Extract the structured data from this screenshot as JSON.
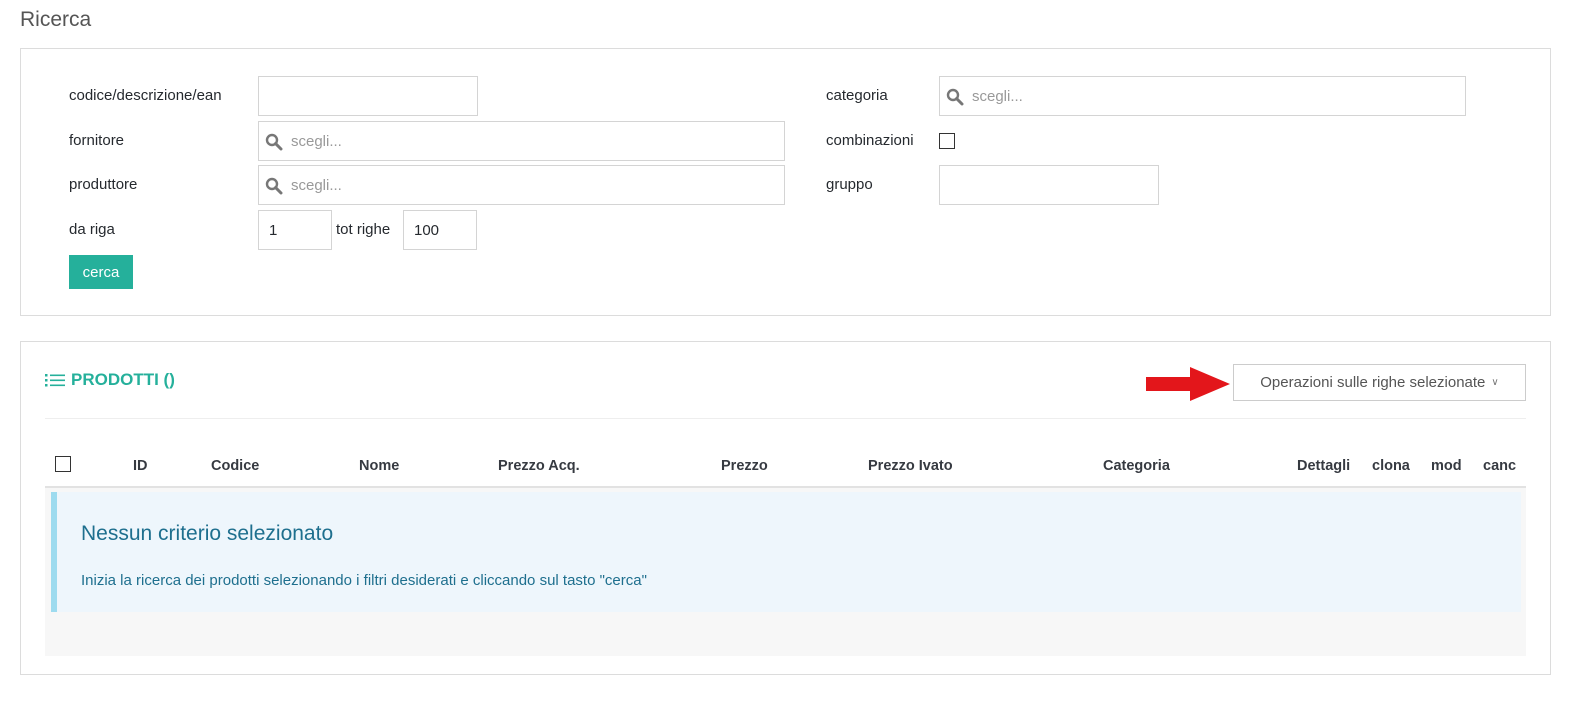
{
  "page": {
    "title": "Ricerca"
  },
  "search": {
    "codice_label": "codice/descrizione/ean",
    "codice_value": "",
    "fornitore_label": "fornitore",
    "fornitore_placeholder": "scegli...",
    "produttore_label": "produttore",
    "produttore_placeholder": "scegli...",
    "da_riga_label": "da riga",
    "da_riga_value": "1",
    "tot_righe_label": "tot righe",
    "tot_righe_value": "100",
    "categoria_label": "categoria",
    "categoria_placeholder": "scegli...",
    "combinazioni_label": "combinazioni",
    "gruppo_label": "gruppo",
    "gruppo_value": "",
    "cerca_label": "cerca"
  },
  "products": {
    "title": "PRODOTTI ()",
    "ops_label": "Operazioni sulle righe selezionate",
    "columns": [
      "ID",
      "Codice",
      "Nome",
      "Prezzo Acq.",
      "Prezzo",
      "Prezzo Ivato",
      "Categoria",
      "Dettagli",
      "clona",
      "mod",
      "canc"
    ],
    "empty_title": "Nessun criterio selezionato",
    "empty_text": "Inizia la ricerca dei prodotti selezionando i filtri desiderati e cliccando sul tasto \"cerca\""
  },
  "colors": {
    "accent": "#25b09b",
    "arrow": "#e3161b",
    "info_text": "#1e6f8e",
    "info_border": "#9ddbef"
  },
  "icons": {
    "search": "magnifier-icon",
    "list": "list-icon",
    "arrow": "red-arrow-icon",
    "chevron": "chevron-down-icon"
  }
}
